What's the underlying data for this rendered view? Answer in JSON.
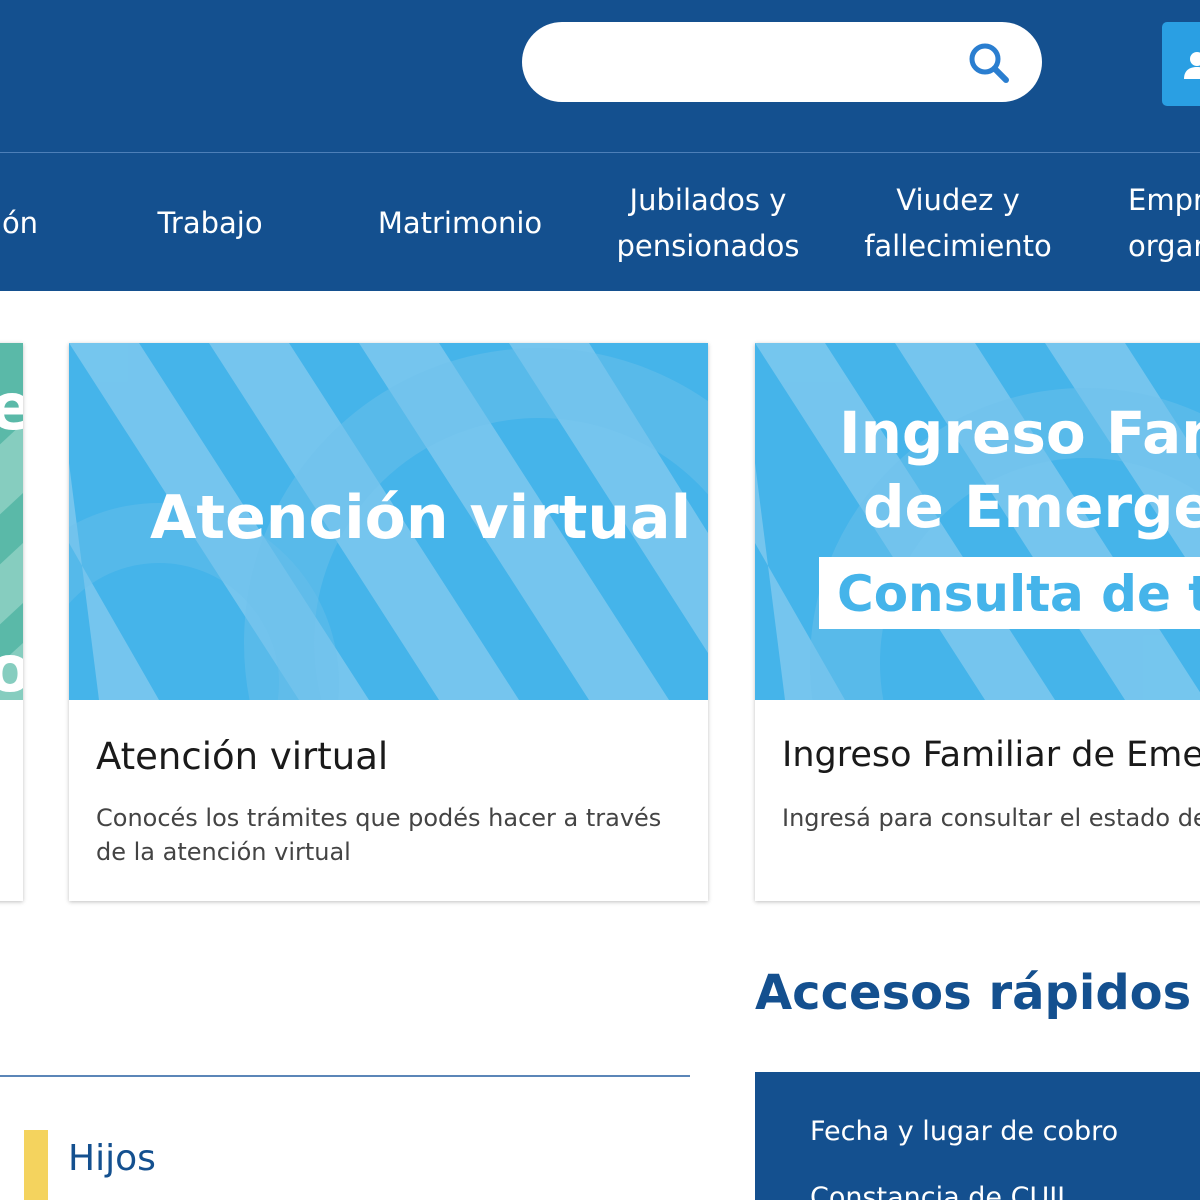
{
  "search": {
    "placeholder": ""
  },
  "nav": {
    "items": [
      {
        "line1": "ón",
        "line2": ""
      },
      {
        "line1": "Trabajo",
        "line2": ""
      },
      {
        "line1": "Matrimonio",
        "line2": ""
      },
      {
        "line1": "Jubilados y",
        "line2": "pensionados"
      },
      {
        "line1": "Viudez y",
        "line2": "fallecimiento"
      },
      {
        "line1": "Empr",
        "line2": "organ"
      }
    ]
  },
  "cards": {
    "left_partial": {
      "banner_letter_1": "e",
      "banner_letter_2": "o"
    },
    "atencion": {
      "banner_text": "Atención virtual",
      "title": "Atención virtual",
      "description": "Conocés los trámites que podés hacer a través de la atención virtual"
    },
    "ife": {
      "banner_line1": "Ingreso Fami",
      "banner_line2": "de Emergen",
      "banner_line3": "Consulta de trá",
      "title": "Ingreso Familiar de Eme",
      "description": "Ingresá para consultar el estado de"
    }
  },
  "accesos": {
    "heading": "Accesos rápidos",
    "items": [
      {
        "label": "Fecha y lugar de cobro"
      },
      {
        "label": "Constancia de CUIL"
      }
    ]
  },
  "sections": {
    "hijos": {
      "label": "Hijos"
    }
  },
  "colors": {
    "primary": "#14508f",
    "accent": "#2a9fe3",
    "banner_blue": "#45b4ea",
    "banner_light": "#7ec9ef",
    "teal": "#5ab9a8",
    "highlight_yellow": "#f4d35e"
  },
  "icons": {
    "search": "search-icon",
    "user": "user-icon"
  }
}
